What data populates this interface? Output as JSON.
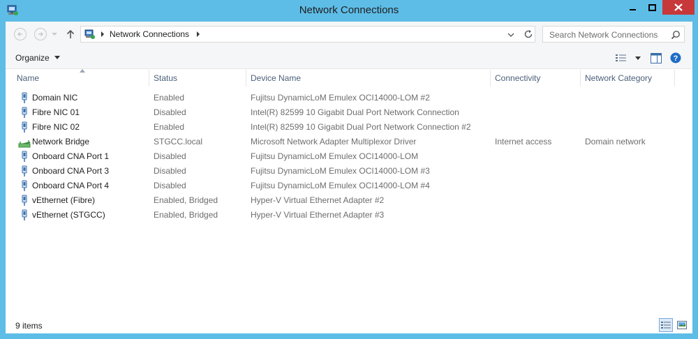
{
  "window": {
    "title": "Network Connections"
  },
  "address": {
    "crumbs": [
      "Network Connections"
    ]
  },
  "search": {
    "placeholder": "Search Network Connections"
  },
  "toolbar": {
    "organize_label": "Organize"
  },
  "columns": [
    "Name",
    "Status",
    "Device Name",
    "Connectivity",
    "Network Category"
  ],
  "connections": [
    {
      "name": "Domain NIC",
      "status": "Enabled",
      "device": "Fujitsu DynamicLoM Emulex OCI14000-LOM #2",
      "connectivity": "",
      "category": "",
      "icon": "ethernet-adapter-icon"
    },
    {
      "name": "Fibre NIC 01",
      "status": "Disabled",
      "device": "Intel(R) 82599 10 Gigabit Dual Port Network Connection",
      "connectivity": "",
      "category": "",
      "icon": "ethernet-adapter-icon"
    },
    {
      "name": "Fibre NIC 02",
      "status": "Enabled",
      "device": "Intel(R) 82599 10 Gigabit Dual Port Network Connection #2",
      "connectivity": "",
      "category": "",
      "icon": "ethernet-adapter-icon"
    },
    {
      "name": "Network Bridge",
      "status": "STGCC.local",
      "device": "Microsoft Network Adapter Multiplexor Driver",
      "connectivity": "Internet access",
      "category": "Domain network",
      "icon": "network-bridge-icon"
    },
    {
      "name": "Onboard CNA Port 1",
      "status": "Disabled",
      "device": "Fujitsu DynamicLoM Emulex OCI14000-LOM",
      "connectivity": "",
      "category": "",
      "icon": "ethernet-adapter-icon"
    },
    {
      "name": "Onboard CNA Port 3",
      "status": "Disabled",
      "device": "Fujitsu DynamicLoM Emulex OCI14000-LOM #3",
      "connectivity": "",
      "category": "",
      "icon": "ethernet-adapter-icon"
    },
    {
      "name": "Onboard CNA Port 4",
      "status": "Disabled",
      "device": "Fujitsu DynamicLoM Emulex OCI14000-LOM #4",
      "connectivity": "",
      "category": "",
      "icon": "ethernet-adapter-icon"
    },
    {
      "name": "vEthernet (Fibre)",
      "status": "Enabled, Bridged",
      "device": "Hyper-V Virtual Ethernet Adapter #2",
      "connectivity": "",
      "category": "",
      "icon": "ethernet-adapter-icon"
    },
    {
      "name": "vEthernet (STGCC)",
      "status": "Enabled, Bridged",
      "device": "Hyper-V Virtual Ethernet Adapter #3",
      "connectivity": "",
      "category": "",
      "icon": "ethernet-adapter-icon"
    }
  ],
  "statusbar": {
    "item_count": "9 items"
  },
  "colors": {
    "frame": "#5ebde7",
    "close_button": "#c7383a",
    "header_text": "#4c607a",
    "secondary_text": "#6d6d6d"
  }
}
